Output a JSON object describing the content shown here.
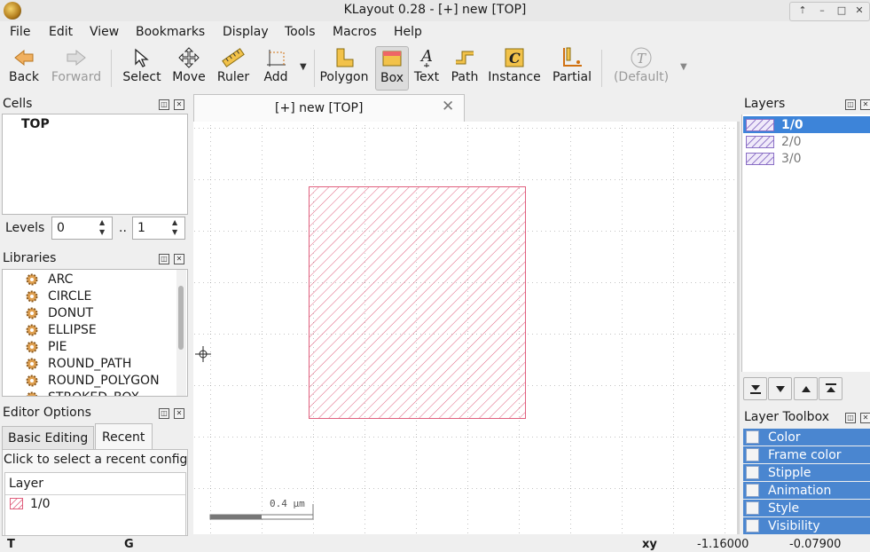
{
  "window": {
    "title": "KLayout 0.28 - [+] new [TOP]"
  },
  "menu": [
    "File",
    "Edit",
    "View",
    "Bookmarks",
    "Display",
    "Tools",
    "Macros",
    "Help"
  ],
  "toolbar": {
    "back": "Back",
    "forward": "Forward",
    "select": "Select",
    "move": "Move",
    "ruler": "Ruler",
    "add": "Add",
    "polygon": "Polygon",
    "box": "Box",
    "text": "Text",
    "path": "Path",
    "instance": "Instance",
    "partial": "Partial",
    "default": "(Default)"
  },
  "cells": {
    "title": "Cells",
    "items": [
      "TOP"
    ]
  },
  "levels": {
    "label": "Levels",
    "from": "0",
    "sep": "..",
    "to": "1"
  },
  "libraries": {
    "title": "Libraries",
    "items": [
      "ARC",
      "CIRCLE",
      "DONUT",
      "ELLIPSE",
      "PIE",
      "ROUND_PATH",
      "ROUND_POLYGON",
      "STROKED_BOX"
    ]
  },
  "editor_options": {
    "title": "Editor Options",
    "tabs": [
      "Basic Editing",
      "Recent"
    ],
    "active_tab": "Recent",
    "hint": "Click to select a recent configuration",
    "column": "Layer",
    "rows": [
      "1/0"
    ]
  },
  "document_tab": {
    "label": "[+] new [TOP]"
  },
  "canvas": {
    "scale_label": "0.4 µm"
  },
  "layers": {
    "title": "Layers",
    "items": [
      {
        "name": "1/0",
        "selected": true
      },
      {
        "name": "2/0",
        "selected": false
      },
      {
        "name": "3/0",
        "selected": false
      }
    ]
  },
  "layer_toolbox": {
    "title": "Layer Toolbox",
    "items": [
      "Color",
      "Frame color",
      "Stipple",
      "Animation",
      "Style",
      "Visibility"
    ]
  },
  "status": {
    "left1": "T",
    "left2": "G",
    "coord_label": "xy",
    "x": "-1.16000",
    "y": "-0.07900"
  },
  "colors": {
    "accent": "#4a86d0",
    "shape": "#e0607e",
    "selection": "#3d84d9"
  }
}
